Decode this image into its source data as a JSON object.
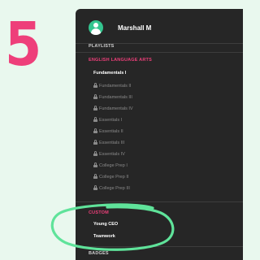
{
  "step_number": "5",
  "user": {
    "name": "Marshall M"
  },
  "sections": {
    "playlists": "PLAYLISTS",
    "english": "ENGLISH LANGUAGE ARTS",
    "custom": "CUSTOM",
    "badges": "BADGES"
  },
  "english_items": [
    "Fundamentals I",
    "Fundamentals II",
    "Fundamentals III",
    "Fundamentals IV",
    "Essentials I",
    "Essentials II",
    "Essentials III",
    "Essentials IV",
    "College Prep I",
    "College Prep II",
    "College Prep III"
  ],
  "custom_items": [
    "Young CEO",
    "Teamwork"
  ],
  "colors": {
    "accent_pink": "#ee3f7a",
    "avatar_green": "#33c58f",
    "highlight_green": "#5fe39a",
    "panel_bg": "#262626",
    "page_bg": "#e9f8ee"
  }
}
